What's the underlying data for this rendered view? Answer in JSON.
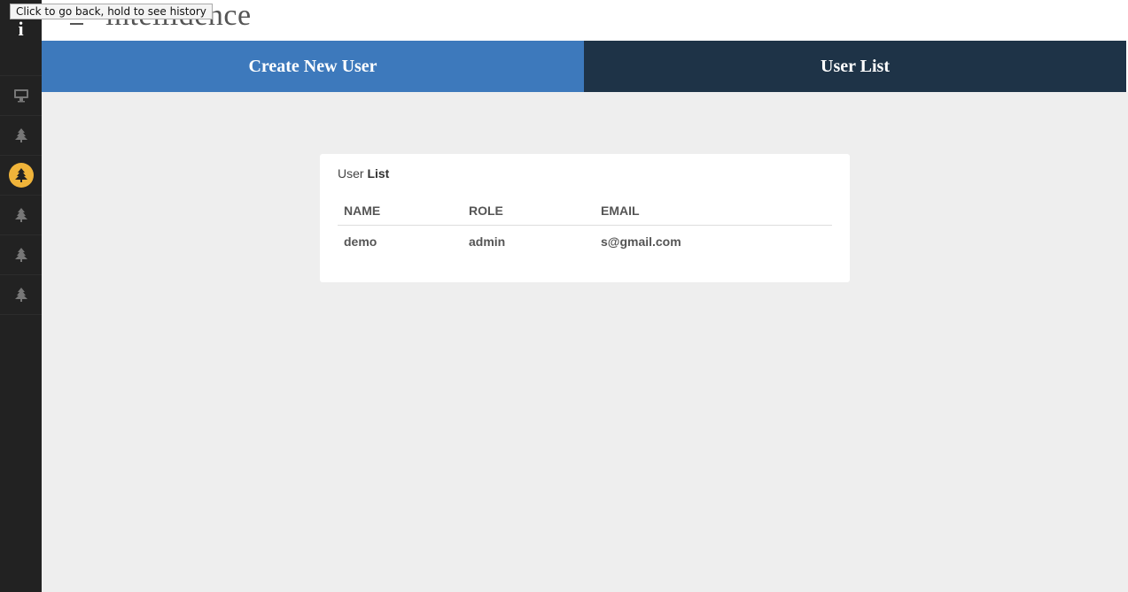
{
  "app": {
    "title": "intellidence",
    "logo_letter": "i"
  },
  "tooltip": "Click to go back, hold to see history",
  "sidebar": {
    "items": [
      {
        "icon": "monitor-icon"
      },
      {
        "icon": "tree-icon"
      },
      {
        "icon": "tree-icon",
        "active": true
      },
      {
        "icon": "tree-icon"
      },
      {
        "icon": "tree-icon"
      },
      {
        "icon": "tree-icon"
      }
    ],
    "active_color": "#f0b43a"
  },
  "tabs": {
    "create_label": "Create New User",
    "list_label": "User List"
  },
  "card": {
    "title_prefix": "User",
    "title_bold": "List",
    "columns": [
      "NAME",
      "ROLE",
      "EMAIL"
    ],
    "rows": [
      {
        "name": "demo",
        "role": "admin",
        "email": "s@gmail.com"
      }
    ]
  }
}
